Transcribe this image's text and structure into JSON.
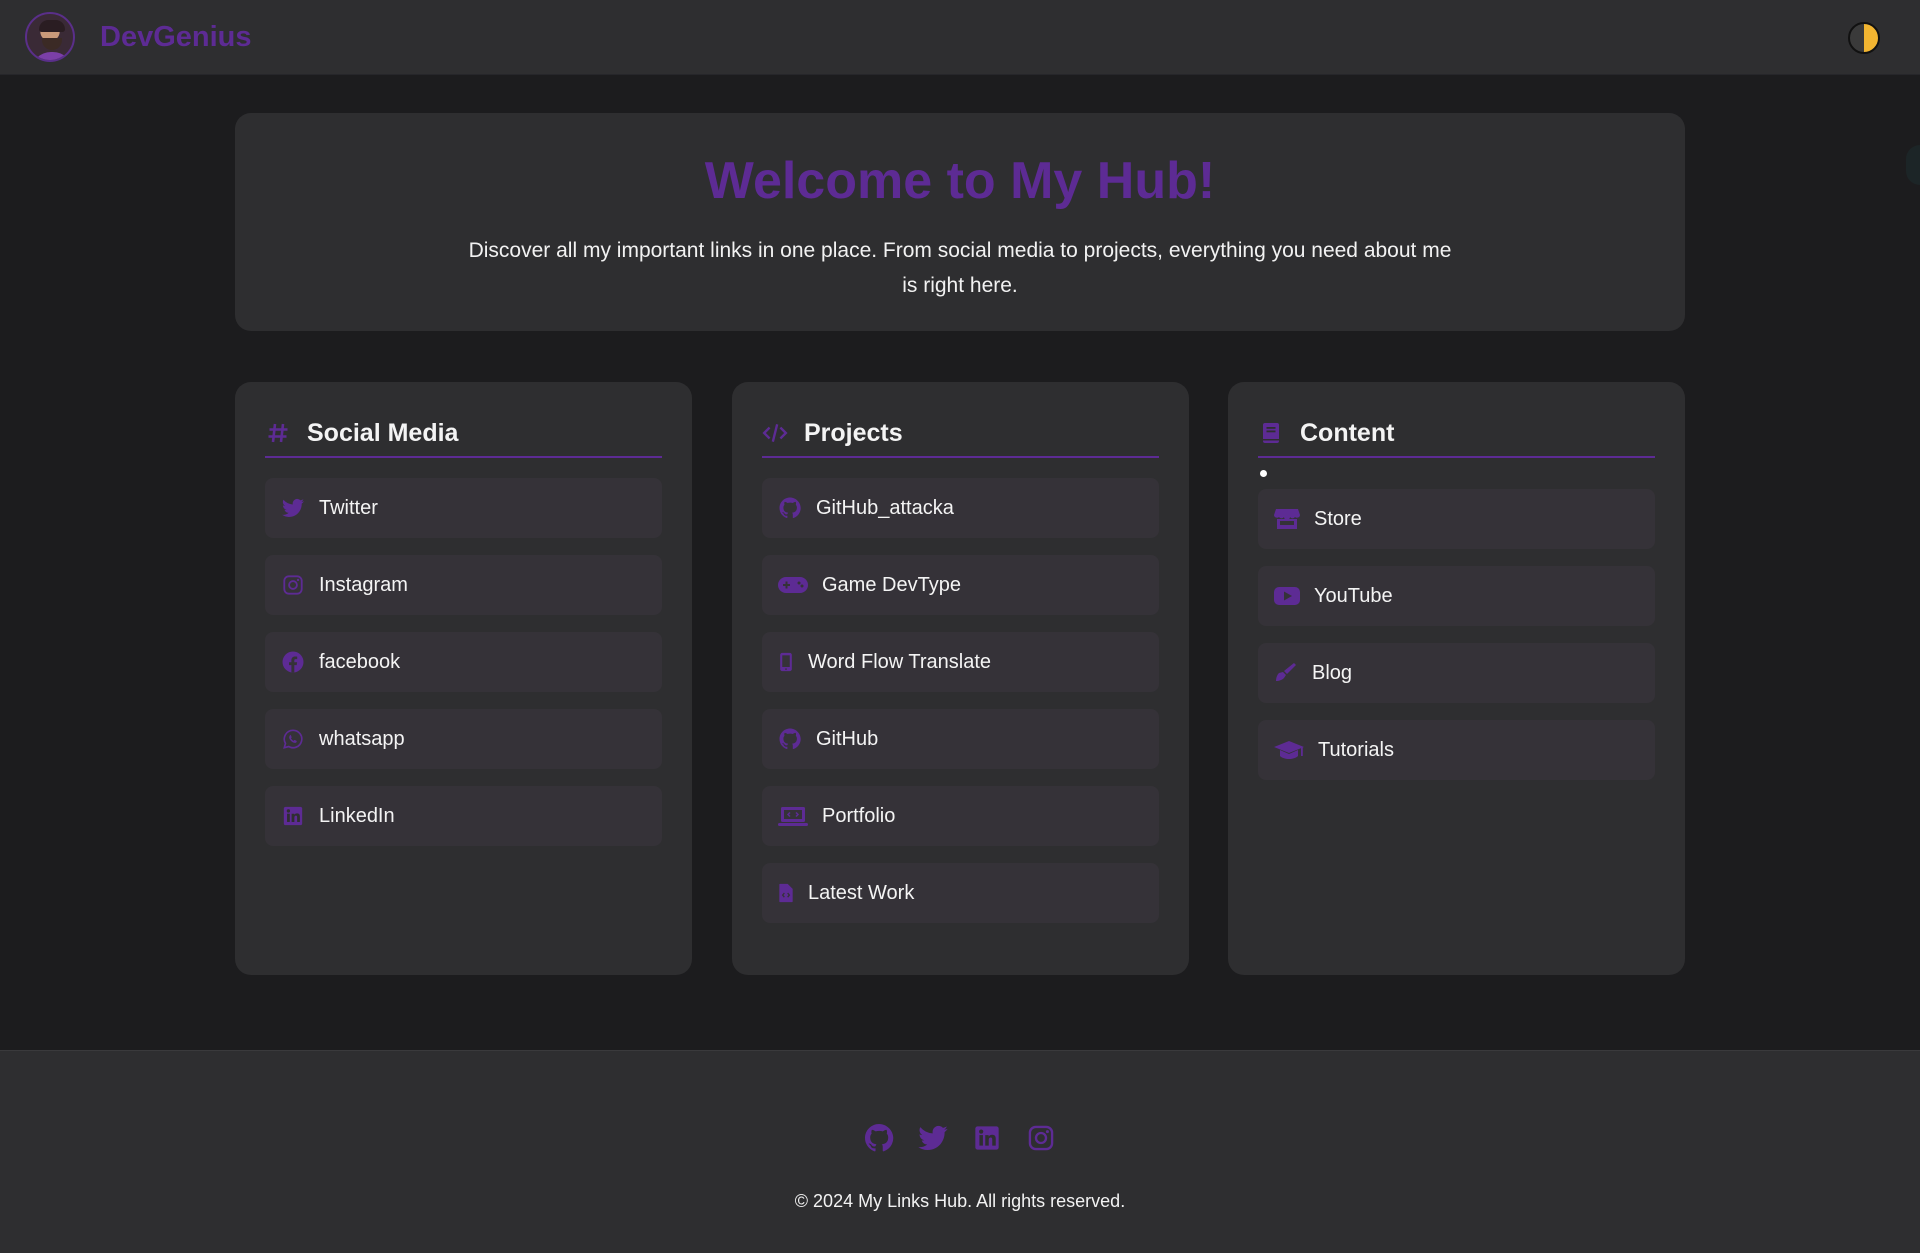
{
  "nav": {
    "brand": "DevGenius"
  },
  "hero": {
    "title": "Welcome to My Hub!",
    "text": "Discover all my important links in one place. From social media to projects, everything you need about me is right here."
  },
  "cards": {
    "social": {
      "title": "Social Media",
      "icon": "hash-icon",
      "links": [
        {
          "label": "Twitter",
          "icon": "twitter-icon"
        },
        {
          "label": "Instagram",
          "icon": "instagram-icon"
        },
        {
          "label": "facebook",
          "icon": "facebook-icon"
        },
        {
          "label": "whatsapp",
          "icon": "whatsapp-icon"
        },
        {
          "label": "LinkedIn",
          "icon": "linkedin-icon"
        }
      ]
    },
    "projects": {
      "title": "Projects",
      "icon": "code-icon",
      "links": [
        {
          "label": "GitHub_attacka",
          "icon": "github-icon"
        },
        {
          "label": "Game DevType",
          "icon": "gamepad-icon"
        },
        {
          "label": "Word Flow Translate",
          "icon": "mobile-icon"
        },
        {
          "label": "GitHub",
          "icon": "github-icon"
        },
        {
          "label": "Portfolio",
          "icon": "laptop-icon"
        },
        {
          "label": "Latest Work",
          "icon": "file-code-icon"
        }
      ]
    },
    "content": {
      "title": "Content",
      "icon": "book-icon",
      "links": [
        {
          "label": "Store",
          "icon": "store-icon"
        },
        {
          "label": "YouTube",
          "icon": "youtube-icon"
        },
        {
          "label": "Blog",
          "icon": "pen-icon"
        },
        {
          "label": "Tutorials",
          "icon": "graduation-cap-icon"
        }
      ]
    }
  },
  "footer": {
    "copyright": "© 2024 My Links Hub. All rights reserved.",
    "icons": [
      "github-icon",
      "twitter-icon",
      "linkedin-icon",
      "instagram-icon"
    ]
  },
  "colors": {
    "accent": "#5d2b94",
    "background": "#1c1c1e",
    "surface": "#2e2e30",
    "link_bg": "#353238",
    "toggle_sun": "#f2b531"
  }
}
